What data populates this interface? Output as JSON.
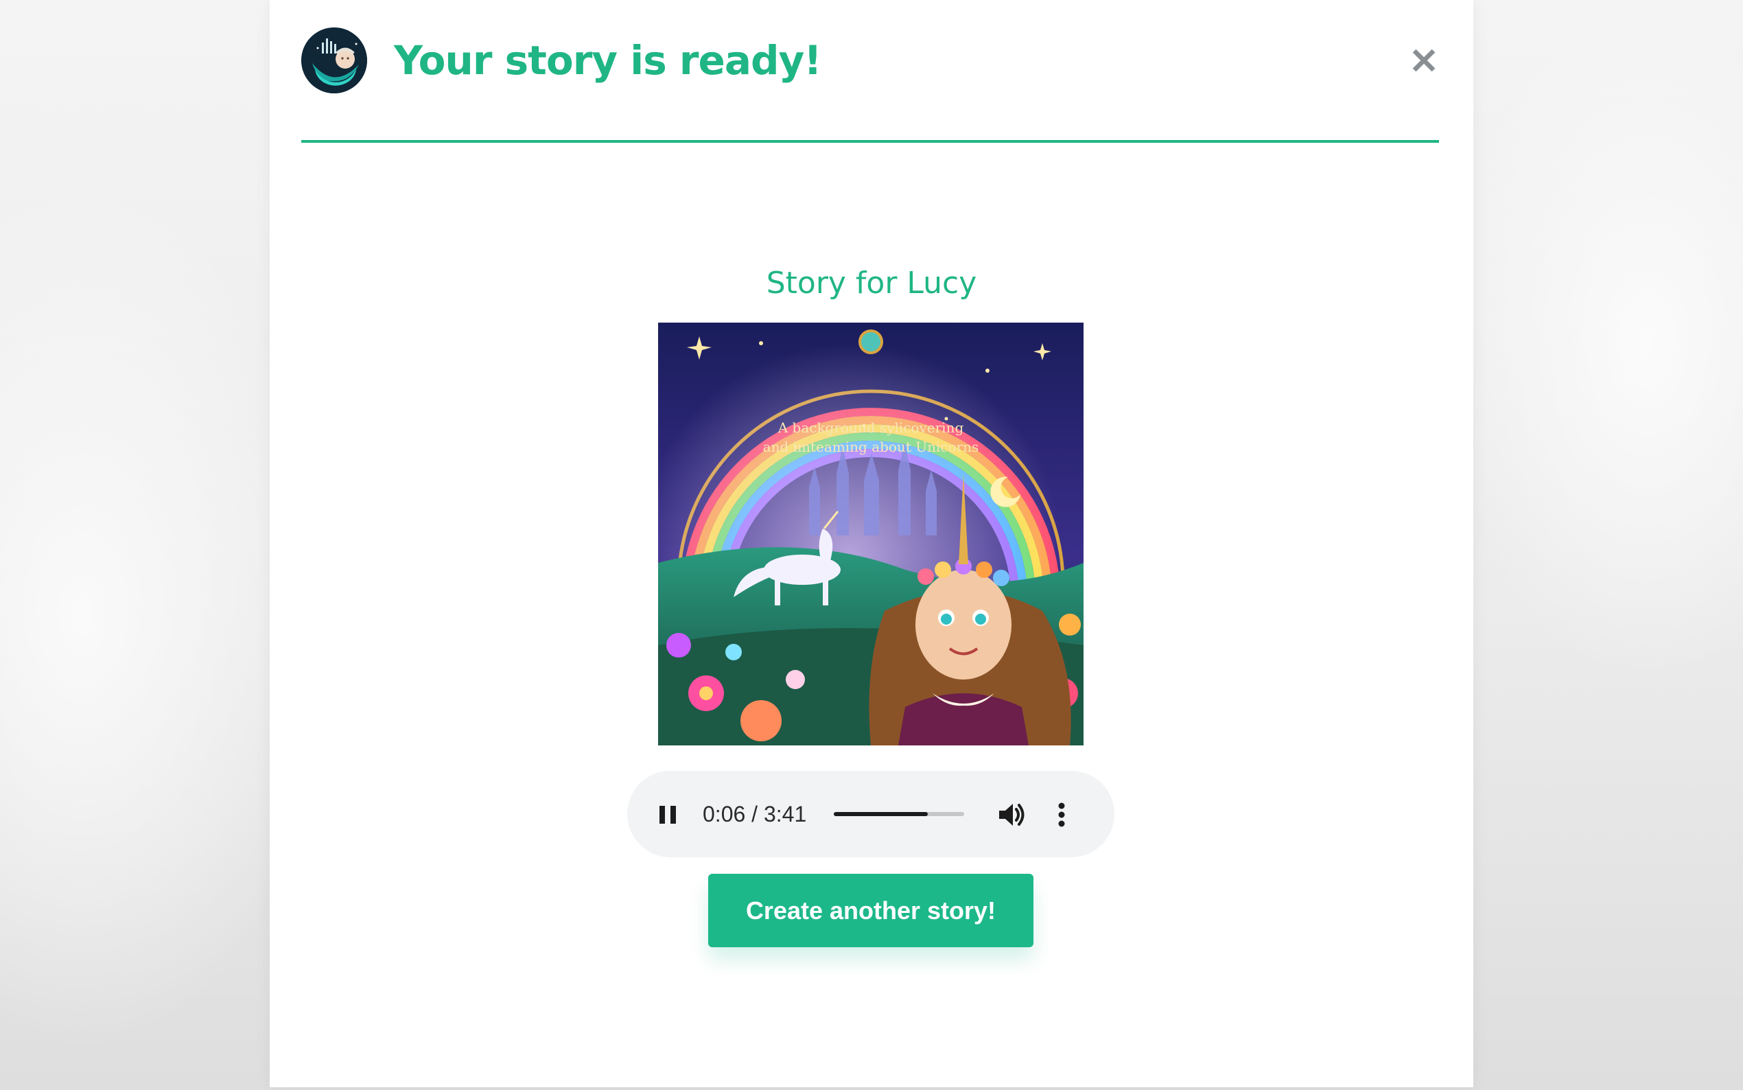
{
  "modal": {
    "title": "Your story is ready!",
    "close_glyph": "✕",
    "logo_icon": "moon-baby-logo-icon"
  },
  "story": {
    "heading": "Story for Lucy",
    "cover_caption_line1": "A background sylicovering",
    "cover_caption_line2": "and imteaming about Unicorns"
  },
  "audio": {
    "state": "playing",
    "time_display": "0:06 / 3:41",
    "progress": 0.72
  },
  "cta": {
    "label": "Create another story!"
  },
  "colors": {
    "accent": "#1fb585",
    "button": "#1cb88a",
    "player_bg": "#f1f3f4"
  }
}
